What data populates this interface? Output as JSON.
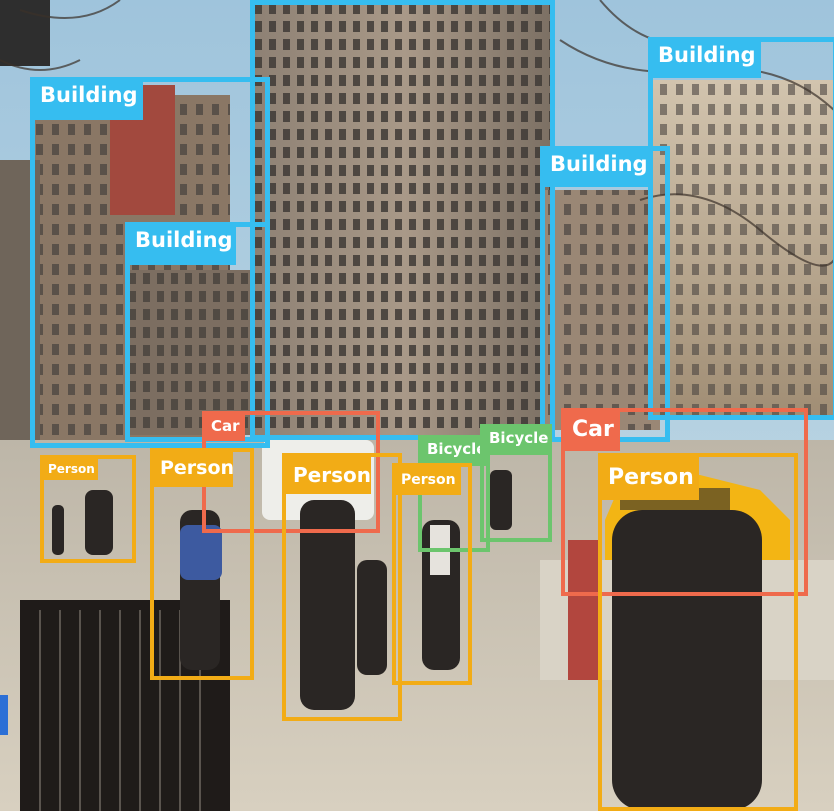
{
  "image": {
    "description_colors": {
      "building": "#36bdf0",
      "car": "#ef6a4c",
      "person": "#f2ac16",
      "bicycle": "#6cc56d"
    }
  },
  "detections": {
    "building_1": "Building",
    "building_2": "Building",
    "building_3": "Building",
    "building_4": "Building",
    "car_1": "Car",
    "car_2": "Car",
    "person_1": "Person",
    "person_2": "Person",
    "person_3": "Person",
    "person_4": "Person",
    "person_5": "Person",
    "bicycle_1": "Bicycle",
    "bicycle_2": "Bicycle"
  }
}
